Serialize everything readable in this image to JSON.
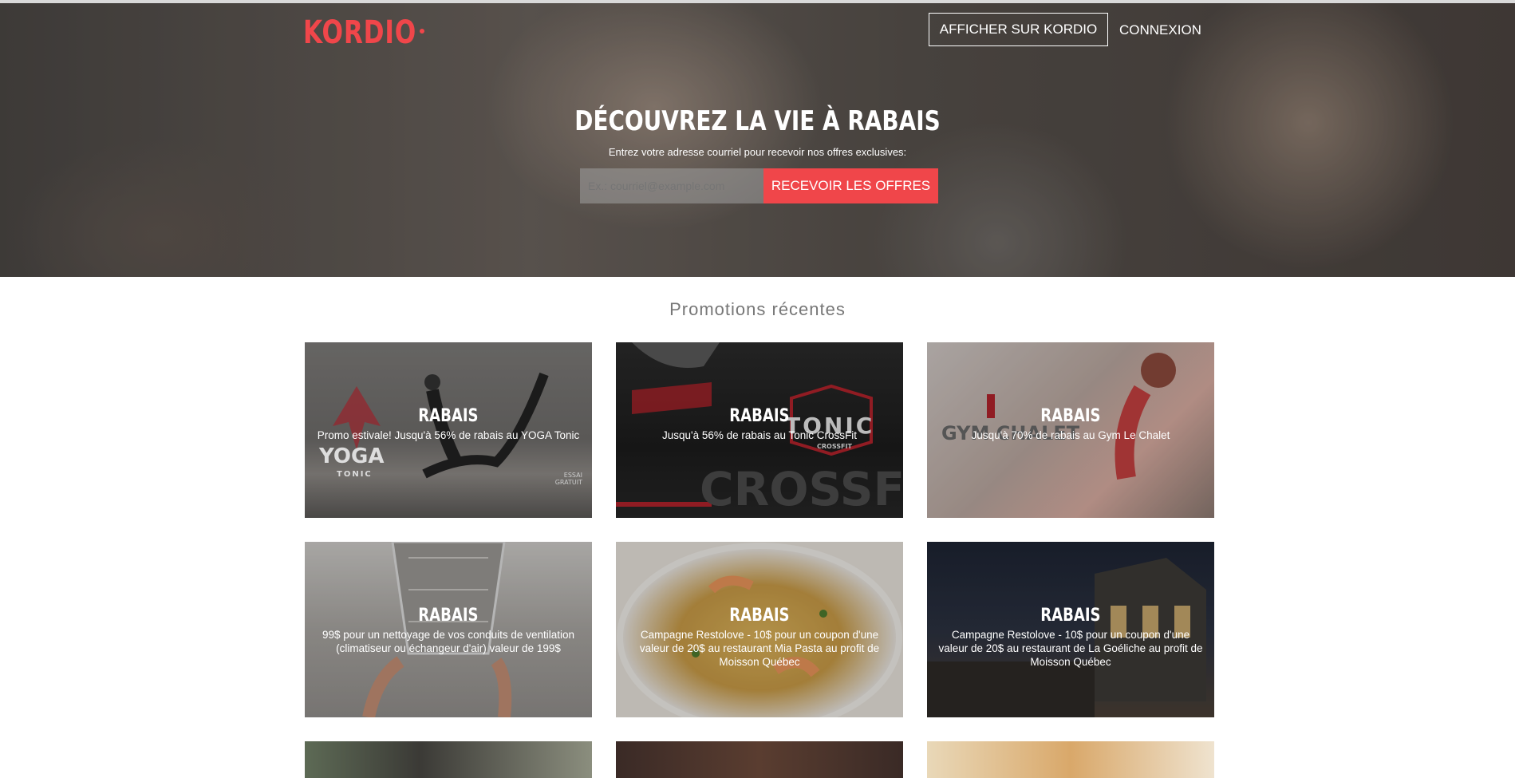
{
  "header": {
    "logo": "KORDIO",
    "show_button": "AFFICHER SUR KORDIO",
    "login": "CONNEXION"
  },
  "hero": {
    "title": "DÉCOUVREZ LA VIE À RABAIS",
    "subtitle": "Entrez votre adresse courriel pour recevoir nos offres exclusives:",
    "email_placeholder": "Ex.: courriel@example.com",
    "cta": "RECEVOIR LES OFFRES"
  },
  "section": {
    "title": "Promotions récentes"
  },
  "promotions": [
    {
      "tag": "RABAIS",
      "text": "Promo estivale! Jusqu'à 56% de rabais au YOGA Tonic"
    },
    {
      "tag": "RABAIS",
      "text": "Jusqu'à 56% de rabais au Tonic CrossFit"
    },
    {
      "tag": "RABAIS",
      "text": "Jusqu'à 70% de rabais au Gym Le Chalet"
    },
    {
      "tag": "RABAIS",
      "text": "99$ pour un nettoyage de vos conduits de ventilation (climatiseur ou échangeur d'air) valeur de 199$"
    },
    {
      "tag": "RABAIS",
      "text": "Campagne Restolove - 10$ pour un coupon d'une valeur de 20$ au restaurant Mia Pasta au profit de Moisson Québec"
    },
    {
      "tag": "RABAIS",
      "text": "Campagne Restolove - 10$ pour un coupon d'une valeur de 20$ au restaurant de La Goéliche au profit de Moisson Québec"
    }
  ],
  "card_art": {
    "yoga_word": "YOGA",
    "yoga_sub": "TONIC",
    "yoga_essai": "ESSAI GRATUIT",
    "tonic_word": "TONIC",
    "crossfit_small": "CROSSFIT",
    "crossfit_big": "CROSSFI",
    "gym_word": "GYM CHALET"
  },
  "colors": {
    "accent": "#f0464a"
  }
}
